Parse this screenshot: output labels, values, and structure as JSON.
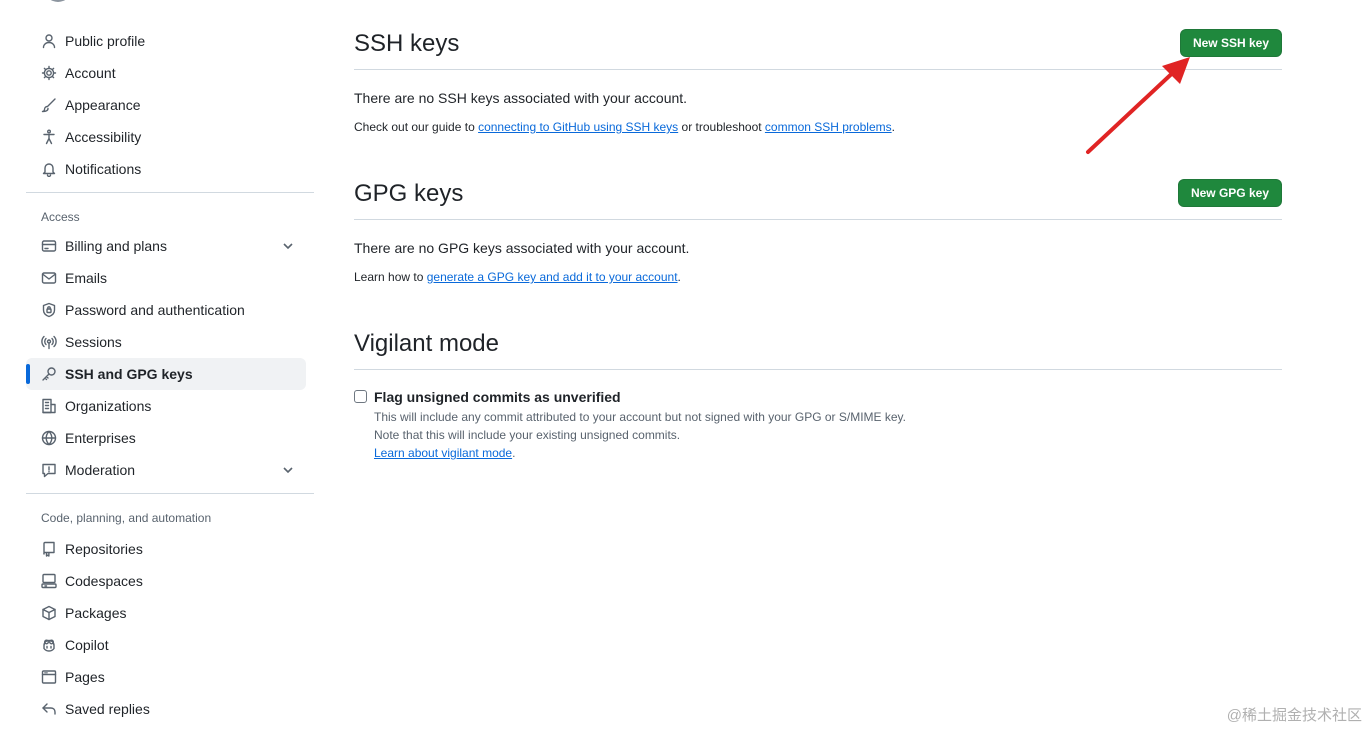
{
  "sidebar": {
    "top_items": [
      {
        "label": "Public profile",
        "icon": "person-icon"
      },
      {
        "label": "Account",
        "icon": "gear-icon"
      },
      {
        "label": "Appearance",
        "icon": "paintbrush-icon"
      },
      {
        "label": "Accessibility",
        "icon": "accessibility-icon"
      },
      {
        "label": "Notifications",
        "icon": "bell-icon"
      }
    ],
    "access_heading": "Access",
    "access_items": [
      {
        "label": "Billing and plans",
        "icon": "credit-card-icon",
        "expandable": true
      },
      {
        "label": "Emails",
        "icon": "mail-icon"
      },
      {
        "label": "Password and authentication",
        "icon": "shield-lock-icon"
      },
      {
        "label": "Sessions",
        "icon": "broadcast-icon"
      },
      {
        "label": "SSH and GPG keys",
        "icon": "key-icon",
        "active": true
      },
      {
        "label": "Organizations",
        "icon": "organization-icon"
      },
      {
        "label": "Enterprises",
        "icon": "globe-icon"
      },
      {
        "label": "Moderation",
        "icon": "report-icon",
        "expandable": true
      }
    ],
    "code_heading": "Code, planning, and automation",
    "code_items": [
      {
        "label": "Repositories",
        "icon": "repo-icon"
      },
      {
        "label": "Codespaces",
        "icon": "codespaces-icon"
      },
      {
        "label": "Packages",
        "icon": "package-icon"
      },
      {
        "label": "Copilot",
        "icon": "copilot-icon"
      },
      {
        "label": "Pages",
        "icon": "browser-icon"
      },
      {
        "label": "Saved replies",
        "icon": "reply-icon"
      }
    ]
  },
  "ssh": {
    "title": "SSH keys",
    "button": "New SSH key",
    "empty_message": "There are no SSH keys associated with your account.",
    "guide_prefix": "Check out our guide to ",
    "guide_link": "connecting to GitHub using SSH keys",
    "guide_middle": " or troubleshoot ",
    "troubleshoot_link": "common SSH problems",
    "guide_suffix": "."
  },
  "gpg": {
    "title": "GPG keys",
    "button": "New GPG key",
    "empty_message": "There are no GPG keys associated with your account.",
    "learn_prefix": "Learn how to ",
    "learn_link": "generate a GPG key and add it to your account",
    "learn_suffix": "."
  },
  "vigilant": {
    "title": "Vigilant mode",
    "checkbox_label": "Flag unsigned commits as unverified",
    "checked": false,
    "note_1": "This will include any commit attributed to your account but not signed with your GPG or S/MIME key.",
    "note_2": "Note that this will include your existing unsigned commits.",
    "learn_link": "Learn about vigilant mode",
    "learn_suffix": "."
  },
  "watermark": "@稀土掘金技术社区",
  "colors": {
    "accent": "#0969da",
    "primary_button": "#1f883d",
    "annotation_arrow": "#e02424"
  }
}
